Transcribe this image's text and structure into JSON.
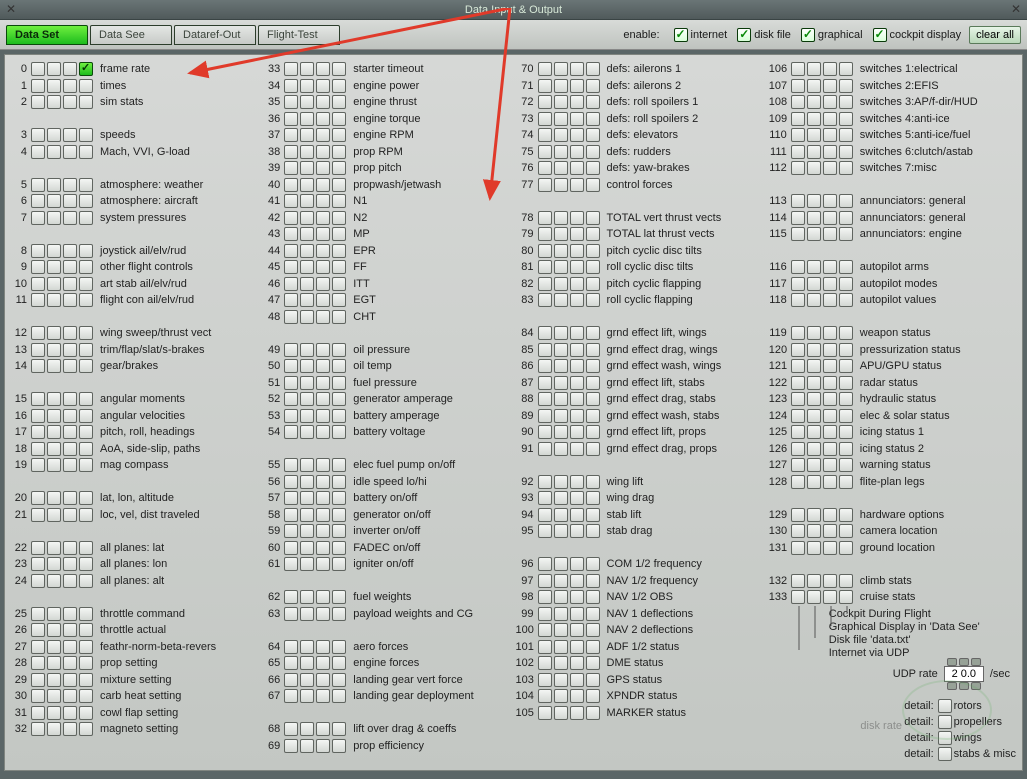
{
  "window": {
    "title": "Data Input & Output",
    "close_left": "✕",
    "close_right": "✕"
  },
  "tabs": [
    {
      "label": "Data Set",
      "active": true
    },
    {
      "label": "Data See",
      "active": false
    },
    {
      "label": "Dataref-Out",
      "active": false
    },
    {
      "label": "Flight-Test",
      "active": false
    }
  ],
  "enable": {
    "label": "enable:",
    "options": [
      {
        "label": "internet"
      },
      {
        "label": "disk file"
      },
      {
        "label": "graphical"
      },
      {
        "label": "cockpit display"
      }
    ]
  },
  "clear_all": "clear all",
  "columns": [
    [
      {
        "n": 0,
        "label": "frame rate",
        "checks": [
          false,
          false,
          false,
          true
        ]
      },
      {
        "n": 1,
        "label": "times"
      },
      {
        "n": 2,
        "label": "sim stats"
      },
      {
        "blank": true
      },
      {
        "n": 3,
        "label": "speeds"
      },
      {
        "n": 4,
        "label": "Mach, VVI, G-load"
      },
      {
        "blank": true
      },
      {
        "n": 5,
        "label": "atmosphere: weather"
      },
      {
        "n": 6,
        "label": "atmosphere: aircraft"
      },
      {
        "n": 7,
        "label": "system pressures"
      },
      {
        "blank": true
      },
      {
        "n": 8,
        "label": "joystick ail/elv/rud"
      },
      {
        "n": 9,
        "label": "other flight controls"
      },
      {
        "n": 10,
        "label": "art stab ail/elv/rud"
      },
      {
        "n": 11,
        "label": "flight con ail/elv/rud"
      },
      {
        "blank": true
      },
      {
        "n": 12,
        "label": "wing sweep/thrust vect"
      },
      {
        "n": 13,
        "label": "trim/flap/slat/s-brakes"
      },
      {
        "n": 14,
        "label": "gear/brakes"
      },
      {
        "blank": true
      },
      {
        "n": 15,
        "label": "angular moments"
      },
      {
        "n": 16,
        "label": "angular velocities"
      },
      {
        "n": 17,
        "label": "pitch, roll, headings"
      },
      {
        "n": 18,
        "label": "AoA, side-slip, paths"
      },
      {
        "n": 19,
        "label": "mag compass"
      },
      {
        "blank": true
      },
      {
        "n": 20,
        "label": "lat, lon, altitude"
      },
      {
        "n": 21,
        "label": "loc, vel, dist traveled"
      },
      {
        "blank": true
      },
      {
        "n": 22,
        "label": "all planes: lat"
      },
      {
        "n": 23,
        "label": "all planes: lon"
      },
      {
        "n": 24,
        "label": "all planes: alt"
      },
      {
        "blank": true
      },
      {
        "n": 25,
        "label": "throttle command"
      },
      {
        "n": 26,
        "label": "throttle actual"
      },
      {
        "n": 27,
        "label": "feathr-norm-beta-revers"
      },
      {
        "n": 28,
        "label": "prop setting"
      },
      {
        "n": 29,
        "label": "mixture setting"
      },
      {
        "n": 30,
        "label": "carb heat setting"
      },
      {
        "n": 31,
        "label": "cowl flap setting"
      },
      {
        "n": 32,
        "label": "magneto setting"
      }
    ],
    [
      {
        "n": 33,
        "label": "starter timeout"
      },
      {
        "n": 34,
        "label": "engine power"
      },
      {
        "n": 35,
        "label": "engine thrust"
      },
      {
        "n": 36,
        "label": "engine torque"
      },
      {
        "n": 37,
        "label": "engine RPM"
      },
      {
        "n": 38,
        "label": "prop RPM"
      },
      {
        "n": 39,
        "label": "prop pitch"
      },
      {
        "n": 40,
        "label": "propwash/jetwash"
      },
      {
        "n": 41,
        "label": "N1"
      },
      {
        "n": 42,
        "label": "N2"
      },
      {
        "n": 43,
        "label": "MP"
      },
      {
        "n": 44,
        "label": "EPR"
      },
      {
        "n": 45,
        "label": "FF"
      },
      {
        "n": 46,
        "label": "ITT"
      },
      {
        "n": 47,
        "label": "EGT"
      },
      {
        "n": 48,
        "label": "CHT"
      },
      {
        "blank": true
      },
      {
        "n": 49,
        "label": "oil pressure"
      },
      {
        "n": 50,
        "label": "oil temp"
      },
      {
        "n": 51,
        "label": "fuel pressure"
      },
      {
        "n": 52,
        "label": "generator amperage"
      },
      {
        "n": 53,
        "label": "battery amperage"
      },
      {
        "n": 54,
        "label": "battery voltage"
      },
      {
        "blank": true
      },
      {
        "n": 55,
        "label": "elec fuel pump on/off"
      },
      {
        "n": 56,
        "label": "idle speed lo/hi"
      },
      {
        "n": 57,
        "label": "battery on/off"
      },
      {
        "n": 58,
        "label": "generator on/off"
      },
      {
        "n": 59,
        "label": "inverter on/off"
      },
      {
        "n": 60,
        "label": "FADEC on/off"
      },
      {
        "n": 61,
        "label": "igniter on/off"
      },
      {
        "blank": true
      },
      {
        "n": 62,
        "label": "fuel weights"
      },
      {
        "n": 63,
        "label": "payload weights and CG"
      },
      {
        "blank": true
      },
      {
        "n": 64,
        "label": "aero forces"
      },
      {
        "n": 65,
        "label": "engine forces"
      },
      {
        "n": 66,
        "label": "landing gear vert force"
      },
      {
        "n": 67,
        "label": "landing gear deployment"
      },
      {
        "blank": true
      },
      {
        "n": 68,
        "label": "lift over drag & coeffs"
      },
      {
        "n": 69,
        "label": "prop efficiency"
      }
    ],
    [
      {
        "n": 70,
        "label": "defs: ailerons 1"
      },
      {
        "n": 71,
        "label": "defs: ailerons 2"
      },
      {
        "n": 72,
        "label": "defs: roll spoilers 1"
      },
      {
        "n": 73,
        "label": "defs: roll spoilers 2"
      },
      {
        "n": 74,
        "label": "defs: elevators"
      },
      {
        "n": 75,
        "label": "defs: rudders"
      },
      {
        "n": 76,
        "label": "defs: yaw-brakes"
      },
      {
        "n": 77,
        "label": "control forces"
      },
      {
        "blank": true
      },
      {
        "n": 78,
        "label": "TOTAL vert thrust vects"
      },
      {
        "n": 79,
        "label": "TOTAL lat  thrust vects"
      },
      {
        "n": 80,
        "label": "pitch cyclic disc tilts"
      },
      {
        "n": 81,
        "label": "roll cyclic disc tilts"
      },
      {
        "n": 82,
        "label": "pitch cyclic flapping"
      },
      {
        "n": 83,
        "label": "roll cyclic flapping"
      },
      {
        "blank": true
      },
      {
        "n": 84,
        "label": "grnd effect lift, wings"
      },
      {
        "n": 85,
        "label": "grnd effect drag, wings"
      },
      {
        "n": 86,
        "label": "grnd effect wash, wings"
      },
      {
        "n": 87,
        "label": "grnd effect lift, stabs"
      },
      {
        "n": 88,
        "label": "grnd effect drag, stabs"
      },
      {
        "n": 89,
        "label": "grnd effect wash, stabs"
      },
      {
        "n": 90,
        "label": "grnd effect lift, props"
      },
      {
        "n": 91,
        "label": "grnd effect drag, props"
      },
      {
        "blank": true
      },
      {
        "n": 92,
        "label": "wing lift"
      },
      {
        "n": 93,
        "label": "wing drag"
      },
      {
        "n": 94,
        "label": "stab lift"
      },
      {
        "n": 95,
        "label": "stab drag"
      },
      {
        "blank": true
      },
      {
        "n": 96,
        "label": "COM 1/2 frequency"
      },
      {
        "n": 97,
        "label": "NAV 1/2 frequency"
      },
      {
        "n": 98,
        "label": "NAV 1/2 OBS"
      },
      {
        "n": 99,
        "label": "NAV 1 deflections"
      },
      {
        "n": 100,
        "label": "NAV 2 deflections"
      },
      {
        "n": 101,
        "label": "ADF 1/2 status"
      },
      {
        "n": 102,
        "label": "DME status"
      },
      {
        "n": 103,
        "label": "GPS status"
      },
      {
        "n": 104,
        "label": "XPNDR status"
      },
      {
        "n": 105,
        "label": "MARKER status"
      }
    ],
    [
      {
        "n": 106,
        "label": "switches 1:electrical"
      },
      {
        "n": 107,
        "label": "switches 2:EFIS"
      },
      {
        "n": 108,
        "label": "switches 3:AP/f-dir/HUD"
      },
      {
        "n": 109,
        "label": "switches 4:anti-ice"
      },
      {
        "n": 110,
        "label": "switches 5:anti-ice/fuel"
      },
      {
        "n": 111,
        "label": "switches 6:clutch/astab"
      },
      {
        "n": 112,
        "label": "switches 7:misc"
      },
      {
        "blank": true
      },
      {
        "n": 113,
        "label": "annunciators: general"
      },
      {
        "n": 114,
        "label": "annunciators: general"
      },
      {
        "n": 115,
        "label": "annunciators: engine"
      },
      {
        "blank": true
      },
      {
        "n": 116,
        "label": "autopilot arms"
      },
      {
        "n": 117,
        "label": "autopilot modes"
      },
      {
        "n": 118,
        "label": "autopilot values"
      },
      {
        "blank": true
      },
      {
        "n": 119,
        "label": "weapon status"
      },
      {
        "n": 120,
        "label": "pressurization status"
      },
      {
        "n": 121,
        "label": "APU/GPU status"
      },
      {
        "n": 122,
        "label": "radar status"
      },
      {
        "n": 123,
        "label": "hydraulic status"
      },
      {
        "n": 124,
        "label": "elec & solar status"
      },
      {
        "n": 125,
        "label": "icing status 1"
      },
      {
        "n": 126,
        "label": "icing status 2"
      },
      {
        "n": 127,
        "label": "warning status"
      },
      {
        "n": 128,
        "label": "flite-plan legs"
      },
      {
        "blank": true
      },
      {
        "n": 129,
        "label": "hardware options"
      },
      {
        "n": 130,
        "label": "camera location"
      },
      {
        "n": 131,
        "label": "ground location"
      },
      {
        "blank": true
      },
      {
        "n": 132,
        "label": "climb stats"
      },
      {
        "n": 133,
        "label": "cruise stats"
      }
    ]
  ],
  "col4_extra": [
    "Cockpit During Flight",
    "Graphical Display in 'Data See'",
    "Disk file 'data.txt'",
    "Internet via UDP"
  ],
  "udp": {
    "label": "UDP rate",
    "value": "2 0.0",
    "unit": "/sec"
  },
  "details": {
    "label": "detail:",
    "rows": [
      {
        "label": "rotors"
      },
      {
        "label": "propellers"
      },
      {
        "label": "wings"
      },
      {
        "label": "stabs & misc"
      }
    ]
  },
  "disk_rate_label": "disk rate"
}
